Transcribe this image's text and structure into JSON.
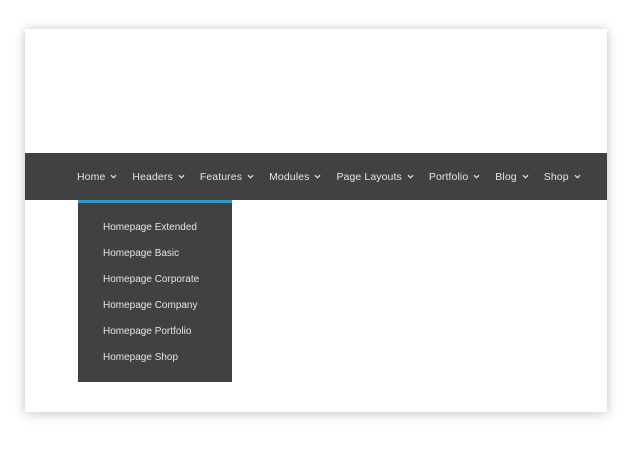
{
  "nav": {
    "items": [
      {
        "label": "Home"
      },
      {
        "label": "Headers"
      },
      {
        "label": "Features"
      },
      {
        "label": "Modules"
      },
      {
        "label": "Page Layouts"
      },
      {
        "label": "Portfolio"
      },
      {
        "label": "Blog"
      },
      {
        "label": "Shop"
      }
    ],
    "background": "#414141",
    "text_color": "#e4e4e4",
    "chevron_icon": "chevron-down-icon"
  },
  "dropdown": {
    "parent": "Home",
    "accent": "#2e98c8",
    "items": [
      {
        "label": "Homepage Extended"
      },
      {
        "label": "Homepage Basic"
      },
      {
        "label": "Homepage Corporate"
      },
      {
        "label": "Homepage Company"
      },
      {
        "label": "Homepage Portfolio"
      },
      {
        "label": "Homepage Shop"
      }
    ]
  }
}
